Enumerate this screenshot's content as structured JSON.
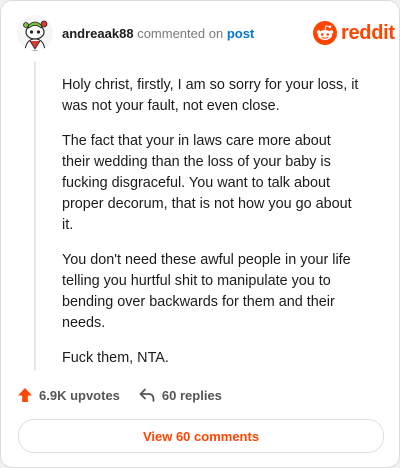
{
  "comment": {
    "username": "andreaak88",
    "action": "commented on",
    "target_link": "post",
    "paragraphs": [
      "Holy christ, firstly, I am so sorry for your loss, it was not your fault, not even close.",
      "The fact that your in laws care more about their wedding than the loss of your baby is fucking disgraceful. You want to talk about proper decorum, that is not how you go about it.",
      "You don't need these awful people in your life telling you hurtful shit to manipulate you to bending over backwards for them and their needs.",
      "Fuck them, NTA."
    ]
  },
  "brand": {
    "name": "reddit",
    "icon": "reddit-snoo-icon",
    "color": "#ff4500"
  },
  "stats": {
    "upvotes_label": "6.9K upvotes",
    "replies_label": "60 replies",
    "upvote_icon": "upvote-arrow-icon",
    "reply_icon": "reply-arrow-icon"
  },
  "actions": {
    "view_comments_label": "View 60 comments"
  },
  "colors": {
    "accent": "#ff4500",
    "link": "#0079d3",
    "text": "#1c1c1c"
  }
}
